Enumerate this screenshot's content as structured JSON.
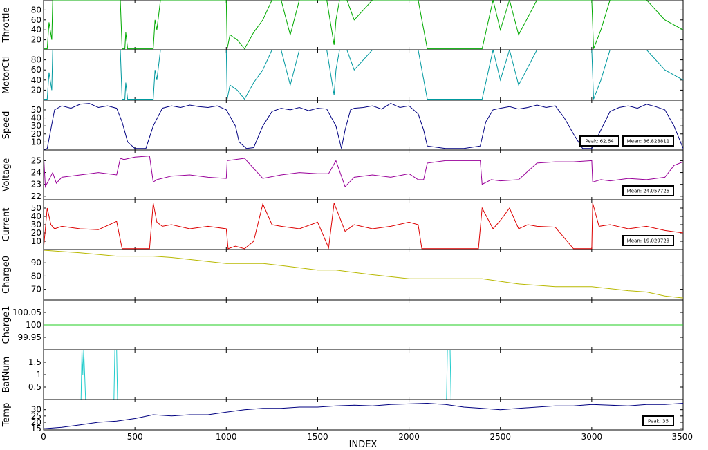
{
  "chart_data": {
    "type": "line",
    "xlabel": "INDEX",
    "xlim": [
      0,
      3500
    ],
    "xticks": [
      0,
      500,
      1000,
      1500,
      2000,
      2500,
      3000,
      3500
    ],
    "panels": [
      {
        "ylabel": "Throttle",
        "color": "#00aa00",
        "ylim": [
          0,
          100
        ],
        "yticks": [
          20,
          40,
          60,
          80
        ],
        "x": [
          0,
          20,
          30,
          45,
          50,
          60,
          80,
          100,
          200,
          300,
          420,
          430,
          445,
          450,
          460,
          480,
          500,
          600,
          610,
          620,
          640,
          800,
          1000,
          1005,
          1020,
          1060,
          1100,
          1150,
          1200,
          1250,
          1300,
          1350,
          1400,
          1500,
          1550,
          1590,
          1600,
          1620,
          1660,
          1700,
          1800,
          1900,
          2000,
          2050,
          2100,
          2300,
          2380,
          2400,
          2460,
          2500,
          2550,
          2600,
          2700,
          2800,
          3000,
          3010,
          3050,
          3100,
          3200,
          3300,
          3400,
          3500
        ],
        "y": [
          2,
          2,
          55,
          20,
          100,
          100,
          100,
          100,
          100,
          100,
          100,
          2,
          2,
          35,
          2,
          2,
          2,
          2,
          60,
          40,
          100,
          100,
          100,
          2,
          30,
          20,
          2,
          35,
          60,
          100,
          100,
          30,
          100,
          100,
          100,
          10,
          60,
          100,
          100,
          60,
          100,
          100,
          100,
          100,
          2,
          2,
          2,
          2,
          100,
          40,
          100,
          30,
          100,
          100,
          100,
          2,
          40,
          100,
          100,
          100,
          60,
          40
        ],
        "stats": []
      },
      {
        "ylabel": "MotorCtl",
        "color": "#00999f",
        "ylim": [
          0,
          100
        ],
        "yticks": [
          20,
          40,
          60,
          80
        ],
        "x": [
          0,
          20,
          30,
          45,
          50,
          60,
          80,
          100,
          200,
          300,
          420,
          430,
          445,
          450,
          460,
          480,
          500,
          600,
          610,
          620,
          640,
          800,
          1000,
          1005,
          1020,
          1060,
          1100,
          1150,
          1200,
          1250,
          1300,
          1350,
          1400,
          1500,
          1550,
          1590,
          1600,
          1620,
          1660,
          1700,
          1800,
          1900,
          2000,
          2050,
          2100,
          2300,
          2380,
          2400,
          2460,
          2500,
          2550,
          2600,
          2700,
          2800,
          3000,
          3010,
          3050,
          3100,
          3200,
          3300,
          3400,
          3500
        ],
        "y": [
          2,
          2,
          55,
          20,
          100,
          100,
          100,
          100,
          100,
          100,
          100,
          2,
          2,
          35,
          2,
          2,
          2,
          2,
          60,
          40,
          100,
          100,
          100,
          2,
          30,
          20,
          2,
          35,
          60,
          100,
          100,
          30,
          100,
          100,
          100,
          10,
          60,
          100,
          100,
          60,
          100,
          100,
          100,
          100,
          2,
          2,
          2,
          2,
          100,
          40,
          100,
          30,
          100,
          100,
          100,
          2,
          40,
          100,
          100,
          100,
          60,
          40
        ],
        "stats": []
      },
      {
        "ylabel": "Speed",
        "color": "#000080",
        "ylim": [
          0,
          62
        ],
        "yticks": [
          10,
          20,
          30,
          40,
          50
        ],
        "x": [
          0,
          20,
          60,
          100,
          150,
          200,
          250,
          300,
          350,
          400,
          430,
          460,
          500,
          560,
          600,
          650,
          700,
          750,
          800,
          850,
          900,
          950,
          1000,
          1050,
          1070,
          1110,
          1150,
          1200,
          1250,
          1300,
          1350,
          1400,
          1450,
          1500,
          1550,
          1600,
          1630,
          1650,
          1680,
          1700,
          1750,
          1800,
          1850,
          1900,
          1950,
          2000,
          2050,
          2080,
          2100,
          2200,
          2300,
          2390,
          2420,
          2460,
          2500,
          2550,
          2600,
          2650,
          2700,
          2750,
          2800,
          2850,
          2900,
          2950,
          3000,
          3050,
          3100,
          3150,
          3200,
          3250,
          3300,
          3350,
          3400,
          3450,
          3500
        ],
        "y": [
          0,
          2,
          50,
          55,
          52,
          57,
          58,
          53,
          55,
          52,
          35,
          10,
          2,
          2,
          30,
          52,
          55,
          53,
          56,
          54,
          53,
          55,
          50,
          30,
          10,
          2,
          3,
          30,
          48,
          52,
          50,
          53,
          49,
          52,
          51,
          30,
          2,
          25,
          50,
          52,
          53,
          55,
          51,
          58,
          53,
          55,
          45,
          25,
          5,
          2,
          2,
          5,
          35,
          50,
          52,
          54,
          51,
          53,
          56,
          53,
          55,
          40,
          20,
          2,
          2,
          25,
          48,
          53,
          55,
          52,
          57,
          54,
          50,
          30,
          2
        ],
        "stats": [
          "Peak: 62.64",
          "Mean: 36.828811"
        ]
      },
      {
        "ylabel": "Voltage",
        "color": "#990099",
        "ylim": [
          21.7,
          25.9
        ],
        "yticks": [
          22,
          23,
          24,
          25
        ],
        "x": [
          0,
          10,
          50,
          70,
          100,
          200,
          300,
          400,
          420,
          440,
          500,
          580,
          600,
          620,
          700,
          800,
          900,
          1000,
          1005,
          1050,
          1100,
          1200,
          1300,
          1400,
          1500,
          1560,
          1600,
          1650,
          1700,
          1800,
          1900,
          2000,
          2050,
          2080,
          2100,
          2200,
          2300,
          2390,
          2400,
          2450,
          2500,
          2600,
          2700,
          2800,
          2900,
          3000,
          3005,
          3050,
          3100,
          3200,
          3300,
          3400,
          3450,
          3500
        ],
        "y": [
          25.6,
          22.8,
          24.0,
          23.1,
          23.6,
          23.8,
          24.0,
          23.8,
          25.2,
          25.1,
          25.3,
          25.4,
          23.2,
          23.4,
          23.7,
          23.8,
          23.6,
          23.5,
          25.0,
          25.1,
          25.2,
          23.5,
          23.8,
          24.0,
          23.9,
          23.9,
          25.0,
          22.8,
          23.6,
          23.8,
          23.6,
          23.9,
          23.4,
          23.4,
          24.8,
          25.0,
          25.0,
          25.0,
          23.0,
          23.4,
          23.3,
          23.4,
          24.8,
          24.9,
          24.9,
          25.0,
          23.2,
          23.4,
          23.3,
          23.5,
          23.4,
          23.6,
          24.6,
          24.9
        ],
        "stats": [
          "Mean: 24.057725"
        ]
      },
      {
        "ylabel": "Current",
        "color": "#dd0000",
        "ylim": [
          0,
          60
        ],
        "yticks": [
          10,
          20,
          30,
          40,
          50
        ],
        "x": [
          0,
          20,
          40,
          60,
          100,
          200,
          300,
          400,
          430,
          500,
          580,
          600,
          620,
          650,
          700,
          800,
          900,
          1000,
          1010,
          1050,
          1100,
          1150,
          1200,
          1250,
          1300,
          1400,
          1500,
          1560,
          1590,
          1650,
          1700,
          1800,
          1900,
          2000,
          2050,
          2070,
          2100,
          2200,
          2300,
          2380,
          2400,
          2460,
          2500,
          2550,
          2600,
          2650,
          2700,
          2800,
          2900,
          3000,
          3005,
          3040,
          3100,
          3200,
          3300,
          3400,
          3500
        ],
        "y": [
          1,
          50,
          30,
          25,
          28,
          25,
          24,
          34,
          1,
          1,
          1,
          56,
          33,
          28,
          30,
          25,
          28,
          25,
          1,
          4,
          1,
          10,
          55,
          30,
          28,
          25,
          33,
          2,
          56,
          22,
          30,
          25,
          28,
          33,
          30,
          1,
          1,
          1,
          1,
          1,
          50,
          25,
          35,
          50,
          25,
          30,
          28,
          27,
          1,
          1,
          56,
          28,
          30,
          25,
          28,
          23,
          20
        ],
        "stats": [
          "Mean: 19.029723"
        ]
      },
      {
        "ylabel": "Charge0",
        "color": "#b8b800",
        "ylim": [
          62,
          100
        ],
        "yticks": [
          70,
          80,
          90
        ],
        "x": [
          0,
          100,
          200,
          400,
          600,
          700,
          800,
          1000,
          1100,
          1200,
          1300,
          1500,
          1600,
          1800,
          2000,
          2100,
          2200,
          2400,
          2500,
          2600,
          2800,
          2900,
          3000,
          3200,
          3300,
          3400,
          3500
        ],
        "y": [
          99.5,
          98.5,
          97.5,
          95,
          95,
          94,
          92.5,
          89.5,
          89.5,
          89.5,
          88,
          84.5,
          84.5,
          81,
          78,
          78,
          78,
          78,
          76,
          74,
          72,
          72,
          72,
          69,
          68,
          65,
          63.5
        ],
        "stats": []
      },
      {
        "ylabel": "Charge1",
        "color": "#22cc22",
        "ylim": [
          99.9,
          100.1
        ],
        "yticks": [
          99.95,
          100,
          100.05
        ],
        "x": [
          0,
          3500
        ],
        "y": [
          100,
          100
        ],
        "stats": []
      },
      {
        "ylabel": "BatNum",
        "color": "#22cccc",
        "ylim": [
          0,
          2
        ],
        "yticks": [
          0.5,
          1,
          1.5
        ],
        "x": [
          0,
          205,
          210,
          215,
          220,
          225,
          230,
          385,
          390,
          400,
          405,
          2205,
          2210,
          2225,
          2230,
          3500
        ],
        "y": [
          0,
          0,
          2,
          1,
          2,
          1,
          0,
          0,
          2,
          2,
          0,
          0,
          2,
          2,
          0,
          0
        ],
        "stats": []
      },
      {
        "ylabel": "Temp",
        "color": "#000080",
        "ylim": [
          14,
          38
        ],
        "yticks": [
          15,
          20,
          25,
          30
        ],
        "x": [
          0,
          100,
          200,
          300,
          400,
          500,
          600,
          700,
          800,
          900,
          1000,
          1100,
          1200,
          1300,
          1400,
          1500,
          1600,
          1700,
          1800,
          1900,
          2000,
          2100,
          2200,
          2300,
          2400,
          2500,
          2600,
          2700,
          2800,
          2900,
          3000,
          3100,
          3200,
          3300,
          3400,
          3500
        ],
        "y": [
          15,
          16,
          18,
          20,
          21,
          23,
          26,
          25,
          26,
          26,
          28,
          30,
          31,
          31,
          32,
          32,
          33,
          33.5,
          33,
          34,
          34.5,
          35,
          34,
          32,
          31,
          30,
          31,
          32,
          33,
          33,
          34,
          33.5,
          33,
          34,
          34,
          35
        ],
        "stats": [
          "Peak: 35"
        ]
      }
    ]
  }
}
